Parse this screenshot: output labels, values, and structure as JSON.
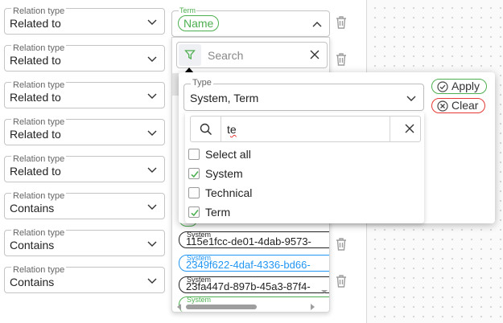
{
  "relations": [
    {
      "legend": "Relation type",
      "value": "Related to"
    },
    {
      "legend": "Relation type",
      "value": "Related to"
    },
    {
      "legend": "Relation type",
      "value": "Related to"
    },
    {
      "legend": "Relation type",
      "value": "Related to"
    },
    {
      "legend": "Relation type",
      "value": "Related to"
    },
    {
      "legend": "Relation type",
      "value": "Contains"
    },
    {
      "legend": "Relation type",
      "value": "Contains"
    },
    {
      "legend": "Relation type",
      "value": "Contains"
    }
  ],
  "term": {
    "legend": "Term",
    "chip": "Name"
  },
  "search": {
    "placeholder": "Search"
  },
  "results": [
    {
      "caption": "System",
      "value": "115e1fcc-de01-4dab-9573-"
    },
    {
      "caption": "System",
      "value": "2349f622-4daf-4336-bd66-"
    },
    {
      "caption": "System",
      "value": "23fa447d-897b-45a3-87f4-"
    },
    {
      "caption": "System",
      "value": ""
    }
  ],
  "type_filter": {
    "legend": "Type",
    "value": "System, Term",
    "apply": "Apply",
    "clear": "Clear",
    "query": {
      "prefix": "t",
      "suffix": "e"
    },
    "options": [
      {
        "label": "Select all",
        "checked": false
      },
      {
        "label": "System",
        "checked": true
      },
      {
        "label": "Technical",
        "checked": false
      },
      {
        "label": "Term",
        "checked": true
      }
    ]
  },
  "colors": {
    "green": "#4caf50",
    "blue": "#2196f3",
    "orange": "#f59a23",
    "red": "#e53935"
  }
}
